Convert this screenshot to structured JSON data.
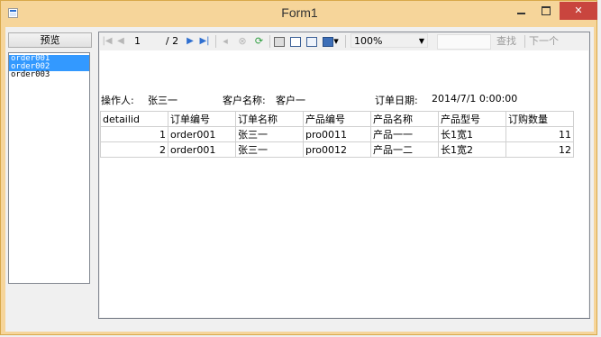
{
  "window": {
    "title": "Form1",
    "close_glyph": "✕"
  },
  "left": {
    "preview_label": "预览",
    "orders": [
      {
        "name": "order001",
        "selected": true
      },
      {
        "name": "order002",
        "selected": true
      },
      {
        "name": "order003",
        "selected": false
      }
    ]
  },
  "toolbar": {
    "current_page": "1",
    "total_pages": "/ 2",
    "zoom": "100%",
    "find_label": "查找",
    "next_label": "下一个",
    "icons": [
      "first-page-icon",
      "prev-page-icon",
      "next-page-icon",
      "last-page-icon",
      "back-icon",
      "stop-icon",
      "refresh-icon",
      "print-icon",
      "print-layout-icon",
      "page-setup-icon",
      "export-icon"
    ]
  },
  "report": {
    "operator_label": "操作人:",
    "operator": "张三一",
    "customer_label": "客户名称:",
    "customer": "客户一",
    "date_label": "订单日期:",
    "date": "2014/7/1 0:00:00",
    "columns": [
      "detailid",
      "订单编号",
      "订单名称",
      "产品编号",
      "产品名称",
      "产品型号",
      "订购数量"
    ],
    "rows": [
      [
        "1",
        "order001",
        "张三一",
        "pro0011",
        "产品一一",
        "长1宽1",
        "11"
      ],
      [
        "2",
        "order001",
        "张三一",
        "pro0012",
        "产品一二",
        "长1宽2",
        "12"
      ]
    ]
  },
  "colors": {
    "frame": "#f6d59a",
    "close": "#c9453e",
    "selection": "#3399ff"
  }
}
